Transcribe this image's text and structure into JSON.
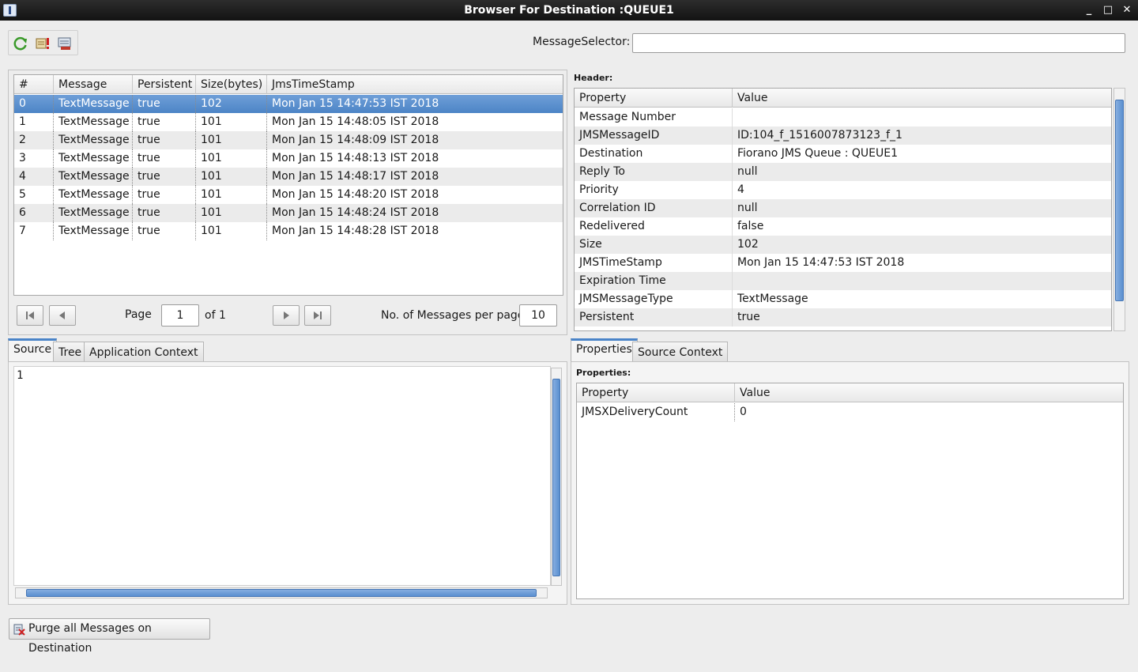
{
  "window": {
    "title": "Browser For Destination :QUEUE1",
    "minimize_glyph": "_",
    "maximize_glyph": "□",
    "close_glyph": "✕"
  },
  "toolbar": {
    "icons": [
      "refresh-icon",
      "message-alert-icon",
      "message-export-icon"
    ]
  },
  "selector": {
    "label": "MessageSelector:",
    "value": ""
  },
  "messages": {
    "columns": [
      "#",
      "Message",
      "Persistent",
      "Size(bytes)",
      "JmsTimeStamp"
    ],
    "rows": [
      [
        "0",
        "TextMessage",
        "true",
        "102",
        "Mon Jan 15 14:47:53 IST 2018"
      ],
      [
        "1",
        "TextMessage",
        "true",
        "101",
        "Mon Jan 15 14:48:05 IST 2018"
      ],
      [
        "2",
        "TextMessage",
        "true",
        "101",
        "Mon Jan 15 14:48:09 IST 2018"
      ],
      [
        "3",
        "TextMessage",
        "true",
        "101",
        "Mon Jan 15 14:48:13 IST 2018"
      ],
      [
        "4",
        "TextMessage",
        "true",
        "101",
        "Mon Jan 15 14:48:17 IST 2018"
      ],
      [
        "5",
        "TextMessage",
        "true",
        "101",
        "Mon Jan 15 14:48:20 IST 2018"
      ],
      [
        "6",
        "TextMessage",
        "true",
        "101",
        "Mon Jan 15 14:48:24 IST 2018"
      ],
      [
        "7",
        "TextMessage",
        "true",
        "101",
        "Mon Jan 15 14:48:28 IST 2018"
      ]
    ],
    "selected_index": 0
  },
  "pagination": {
    "page_label": "Page",
    "page_value": "1",
    "of_label": "of 1",
    "per_page_label": "No. of Messages per page",
    "per_page_value": "10"
  },
  "header": {
    "label": "Header:",
    "columns": [
      "Property",
      "Value"
    ],
    "rows": [
      [
        "Message Number",
        ""
      ],
      [
        "JMSMessageID",
        "ID:104_f_1516007873123_f_1"
      ],
      [
        "Destination",
        "Fiorano JMS Queue : QUEUE1"
      ],
      [
        "Reply To",
        "null"
      ],
      [
        "Priority",
        "4"
      ],
      [
        "Correlation ID",
        "null"
      ],
      [
        "Redelivered",
        "false"
      ],
      [
        "Size",
        "102"
      ],
      [
        "JMSTimeStamp",
        "Mon Jan 15 14:47:53 IST 2018"
      ],
      [
        "Expiration Time",
        ""
      ],
      [
        "JMSMessageType",
        "TextMessage"
      ],
      [
        "Persistent",
        "true"
      ]
    ]
  },
  "left_tabs": [
    "Source",
    "Tree",
    "Application Context"
  ],
  "left_active_tab": "Source",
  "source": {
    "content": "1"
  },
  "right_tabs": [
    "Properties",
    "Source Context"
  ],
  "right_active_tab": "Properties",
  "properties": {
    "label": "Properties:",
    "columns": [
      "Property",
      "Value"
    ],
    "rows": [
      [
        "JMSXDeliveryCount",
        "0"
      ]
    ]
  },
  "purge_button": {
    "label": "Purge all Messages on Destination"
  },
  "colors": {
    "selection": "#5a8fd0",
    "title_bar": "#1c1c1c",
    "background": "#ededed",
    "accent": "#4a84c8"
  }
}
